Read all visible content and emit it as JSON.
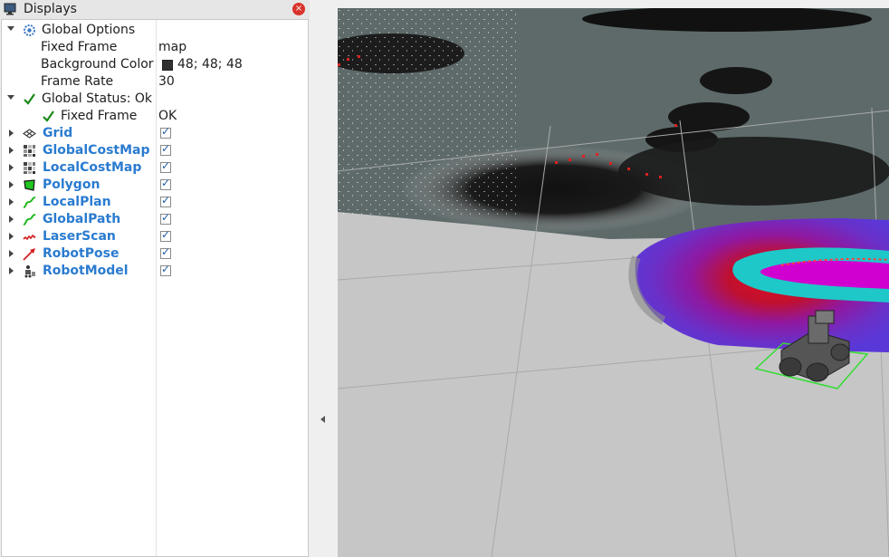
{
  "panel": {
    "title": "Displays",
    "close_label": "×"
  },
  "global_options": {
    "label": "Global Options",
    "fixed_frame_label": "Fixed Frame",
    "fixed_frame_value": "map",
    "background_color_label": "Background Color",
    "background_color_value": "48; 48; 48",
    "background_color_hex": "#303030",
    "frame_rate_label": "Frame Rate",
    "frame_rate_value": "30"
  },
  "global_status": {
    "label": "Global Status: Ok",
    "fixed_frame_label": "Fixed Frame",
    "fixed_frame_value": "OK"
  },
  "displays": [
    {
      "label": "Grid",
      "icon": "grid-icon",
      "enabled": true
    },
    {
      "label": "GlobalCostMap",
      "icon": "map-icon",
      "enabled": true
    },
    {
      "label": "LocalCostMap",
      "icon": "map-icon",
      "enabled": true
    },
    {
      "label": "Polygon",
      "icon": "polygon-icon",
      "enabled": true
    },
    {
      "label": "LocalPlan",
      "icon": "path-icon",
      "enabled": true
    },
    {
      "label": "GlobalPath",
      "icon": "path-icon",
      "enabled": true
    },
    {
      "label": "LaserScan",
      "icon": "laserscan-icon",
      "enabled": true
    },
    {
      "label": "RobotPose",
      "icon": "pose-icon",
      "enabled": true
    },
    {
      "label": "RobotModel",
      "icon": "robot-model-icon",
      "enabled": true
    }
  ],
  "colors": {
    "accent": "#2a7bd0",
    "status_ok": "#1a8a1a",
    "costmap_red": "#c8102e",
    "costmap_magenta": "#d000d0",
    "costmap_cyan": "#1ec8c8",
    "footprint_green": "#33dd33"
  }
}
